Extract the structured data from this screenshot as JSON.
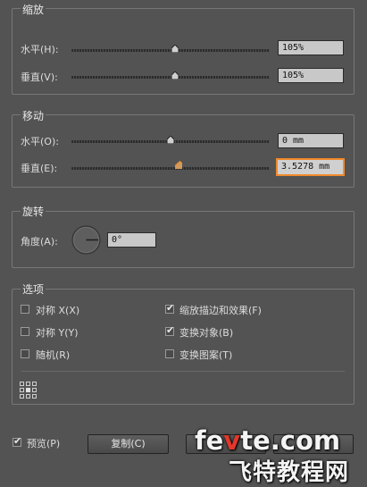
{
  "scale": {
    "title": "缩放",
    "horizontal": {
      "label": "水平(H):",
      "value": "105%",
      "slider_fraction": 0.5
    },
    "vertical": {
      "label": "垂直(V):",
      "value": "105%",
      "slider_fraction": 0.5
    }
  },
  "move": {
    "title": "移动",
    "horizontal": {
      "label": "水平(O):",
      "value": "0 mm",
      "slider_fraction": 0.5
    },
    "vertical": {
      "label": "垂直(E):",
      "value": "3.5278 mm",
      "slider_fraction": 0.54
    }
  },
  "rotate": {
    "title": "旋转",
    "angle": {
      "label": "角度(A):",
      "value": "0°"
    }
  },
  "options": {
    "title": "选项",
    "reflect_x": {
      "label": "对称 X(X)",
      "checked": false
    },
    "reflect_y": {
      "label": "对称 Y(Y)",
      "checked": false
    },
    "random": {
      "label": "随机(R)",
      "checked": false
    },
    "scale_strokes": {
      "label": "缩放描边和效果(F)",
      "checked": true
    },
    "transform_objects": {
      "label": "变换对象(B)",
      "checked": true
    },
    "transform_patterns": {
      "label": "变换图案(T)",
      "checked": false
    }
  },
  "footer": {
    "preview": {
      "label": "预览(P)",
      "checked": true
    },
    "copy_label": "复制(C)"
  },
  "watermark": {
    "line1a": "fe",
    "line1b": "v",
    "line1c": "te.com",
    "line2": "飞特教程网"
  },
  "colors": {
    "accent": "#f08a2d",
    "background": "#535353",
    "watermark_red": "#e2372b"
  }
}
